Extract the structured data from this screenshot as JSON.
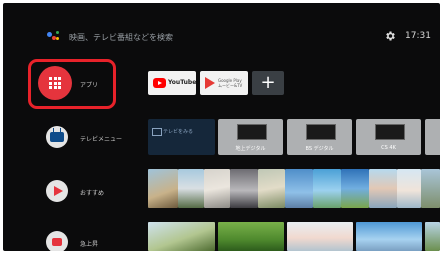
{
  "topbar": {
    "search_hint": "映画、テレビ番組などを検索",
    "clock": "17:31",
    "assistant_colors": [
      "#4285f4",
      "#ea4335",
      "#fbbc05",
      "#34a853"
    ]
  },
  "rows": {
    "apps": {
      "label": "アプリ",
      "tiles": [
        {
          "name": "YouTube",
          "label": "YouTube"
        },
        {
          "name": "Google Play",
          "label": "Google Play ムービー&TV"
        },
        {
          "name": "add",
          "label": "+"
        }
      ]
    },
    "tv_menu": {
      "label": "テレビメニュー",
      "input_tile": "テレビをみる",
      "sources": [
        "地上デジタル",
        "BS デジタル",
        "CS 4K",
        ""
      ]
    },
    "recommended": {
      "label": "おすすめ"
    },
    "uploaded": {
      "label": "急上昇"
    }
  },
  "colors": {
    "accent_red": "#e5343d",
    "highlight": "#e8222a",
    "background": "#0b0b0c"
  }
}
